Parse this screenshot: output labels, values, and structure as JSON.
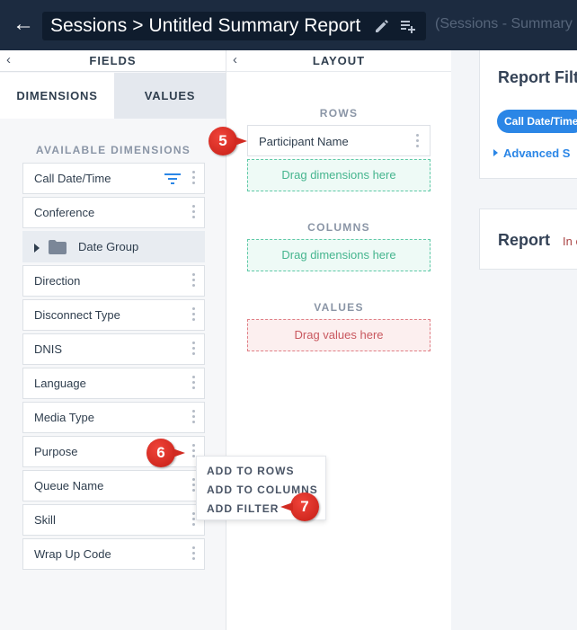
{
  "header": {
    "breadcrumb_root": "Sessions",
    "breadcrumb_sep": ">",
    "report_name": "Untitled Summary Report",
    "subtitle": "(Sessions - Summary"
  },
  "fields_panel": {
    "title": "FIELDS",
    "tabs": [
      {
        "label": "DIMENSIONS",
        "active": true
      },
      {
        "label": "VALUES",
        "active": false
      }
    ],
    "available_label": "AVAILABLE DIMENSIONS",
    "dimensions": [
      {
        "label": "Call Date/Time",
        "filtered": true
      },
      {
        "label": "Conference"
      },
      {
        "label": "Date Group",
        "group": true
      },
      {
        "label": "Direction"
      },
      {
        "label": "Disconnect Type"
      },
      {
        "label": "DNIS"
      },
      {
        "label": "Language"
      },
      {
        "label": "Media Type"
      },
      {
        "label": "Purpose"
      },
      {
        "label": "Queue Name"
      },
      {
        "label": "Skill"
      },
      {
        "label": "Wrap Up Code"
      }
    ]
  },
  "context_menu": {
    "items": [
      "ADD TO ROWS",
      "ADD TO COLUMNS",
      "ADD FILTER"
    ]
  },
  "layout_panel": {
    "title": "LAYOUT",
    "rows_label": "ROWS",
    "rows": [
      "Participant Name"
    ],
    "rows_placeholder": "Drag dimensions here",
    "columns_label": "COLUMNS",
    "columns_placeholder": "Drag dimensions here",
    "values_label": "VALUES",
    "values_placeholder": "Drag values here"
  },
  "report_panel": {
    "filters_title": "Report Filt",
    "filter_chip": "Call Date/Time",
    "advanced_link": "Advanced S",
    "report_title": "Report",
    "report_subtitle": "In c"
  },
  "callouts": [
    "5",
    "6",
    "7"
  ],
  "colors": {
    "header_bg": "#1c2b40",
    "accent_blue": "#2b86e6",
    "drop_green": "#5fc9a7",
    "drop_red": "#e07f86",
    "callout_red": "#d12a21"
  }
}
